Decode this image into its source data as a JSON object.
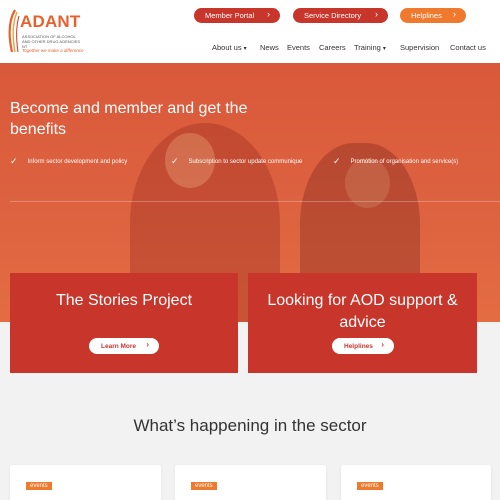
{
  "brand": {
    "name": "ADANT",
    "subtitle": "Association of Alcohol and Other Drug Agencies NT",
    "tagline": "Together we make a difference",
    "color_primary": "#c8352b",
    "color_accent": "#ef7a2d"
  },
  "top_buttons": [
    {
      "label": "Member Portal"
    },
    {
      "label": "Service Directory"
    },
    {
      "label": "Helplines"
    }
  ],
  "nav": [
    {
      "label": "About us",
      "has_dropdown": true
    },
    {
      "label": "News",
      "has_dropdown": false
    },
    {
      "label": "Events",
      "has_dropdown": false
    },
    {
      "label": "Careers",
      "has_dropdown": false
    },
    {
      "label": "Training",
      "has_dropdown": true
    },
    {
      "label": "Supervision",
      "has_dropdown": false
    },
    {
      "label": "Contact us",
      "has_dropdown": false
    }
  ],
  "hero": {
    "title": "Become and member and get the benefits",
    "benefits": [
      "Inform sector development and policy",
      "Subscription to sector update communique",
      "Promotion of organisation and service(s)"
    ]
  },
  "cards": [
    {
      "title": "The Stories Project",
      "button": "Learn More"
    },
    {
      "title": "Looking for AOD support & advice",
      "button": "Helplines"
    }
  ],
  "sector": {
    "title": "What’s happening in the sector",
    "items": [
      {
        "tag": "events"
      },
      {
        "tag": "events"
      },
      {
        "tag": "events"
      }
    ]
  },
  "icons": {
    "chevron": "chevron-right-icon",
    "check": "check-icon",
    "caret": "caret-down-icon"
  }
}
